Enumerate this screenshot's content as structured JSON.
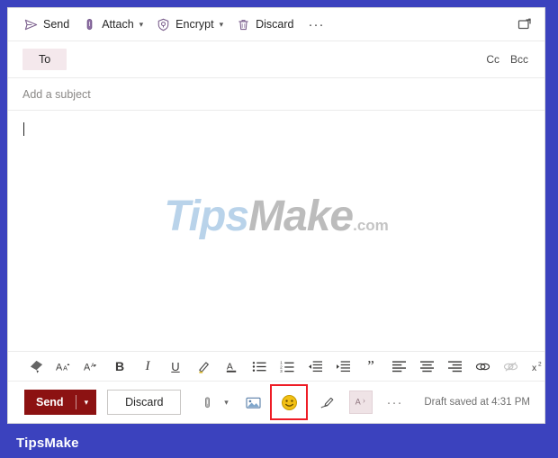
{
  "window": {
    "frame_color": "#3b42be",
    "background": "#ffffff"
  },
  "command_bar": {
    "items": [
      {
        "id": "send",
        "label": "Send",
        "icon": "send-icon",
        "has_chevron": false
      },
      {
        "id": "attach",
        "label": "Attach",
        "icon": "paperclip-icon",
        "has_chevron": true
      },
      {
        "id": "encrypt",
        "label": "Encrypt",
        "icon": "shield-lock-icon",
        "has_chevron": true
      },
      {
        "id": "discard",
        "label": "Discard",
        "icon": "trash-icon",
        "has_chevron": false
      }
    ],
    "overflow_label": "···",
    "popout_icon": "pop-out-icon"
  },
  "recipients": {
    "to_label": "To",
    "to_value": "",
    "to_placeholder": "",
    "cc_label": "Cc",
    "bcc_label": "Bcc"
  },
  "subject": {
    "value": "",
    "placeholder": "Add a subject"
  },
  "body": {
    "value": "",
    "placeholder": "",
    "watermark": {
      "part1": "Tips",
      "part2": "Make",
      "part3": ".com"
    }
  },
  "format_bar": {
    "items": [
      {
        "id": "format-painter",
        "icon": "format-painter-icon",
        "glyph": "✐",
        "disabled": false
      },
      {
        "id": "grow-font",
        "icon": "grow-font-icon",
        "glyph": "Aᴀ",
        "disabled": false
      },
      {
        "id": "shrink-font",
        "icon": "shrink-font-icon",
        "glyph": "Aˉ",
        "disabled": false
      },
      {
        "id": "bold",
        "icon": "bold-icon",
        "glyph": "B",
        "disabled": false
      },
      {
        "id": "italic",
        "icon": "italic-icon",
        "glyph": "I",
        "disabled": false
      },
      {
        "id": "underline",
        "icon": "underline-icon",
        "glyph": "U",
        "disabled": false
      },
      {
        "id": "highlight",
        "icon": "highlight-icon",
        "glyph": "✐",
        "disabled": false
      },
      {
        "id": "font-color",
        "icon": "font-color-icon",
        "glyph": "A",
        "disabled": false
      },
      {
        "id": "bulleted-list",
        "icon": "bulleted-list-icon",
        "glyph": "≡",
        "disabled": false
      },
      {
        "id": "numbered-list",
        "icon": "numbered-list-icon",
        "glyph": "≡",
        "disabled": false
      },
      {
        "id": "decrease-indent",
        "icon": "decrease-indent-icon",
        "glyph": "⇤",
        "disabled": false
      },
      {
        "id": "increase-indent",
        "icon": "increase-indent-icon",
        "glyph": "⇥",
        "disabled": false
      },
      {
        "id": "quote",
        "icon": "quote-icon",
        "glyph": "”",
        "disabled": false
      },
      {
        "id": "align-left",
        "icon": "align-left-icon",
        "glyph": "≡",
        "disabled": false
      },
      {
        "id": "align-center",
        "icon": "align-center-icon",
        "glyph": "≡",
        "disabled": false
      },
      {
        "id": "align-right",
        "icon": "align-right-icon",
        "glyph": "≡",
        "disabled": false
      },
      {
        "id": "insert-link",
        "icon": "link-icon",
        "glyph": "⚭",
        "disabled": false
      },
      {
        "id": "remove-link",
        "icon": "remove-link-icon",
        "glyph": "⚭",
        "disabled": true
      },
      {
        "id": "superscript",
        "icon": "superscript-icon",
        "glyph": "x²",
        "disabled": false
      }
    ],
    "overflow_label": "···"
  },
  "action_bar": {
    "send_label": "Send",
    "send_chevron": "∨",
    "send_color": "#8c1212",
    "discard_label": "Discard",
    "icons": [
      {
        "id": "attach-file",
        "icon": "paperclip-icon",
        "has_chevron": true
      },
      {
        "id": "insert-picture",
        "icon": "picture-icon",
        "has_chevron": false
      }
    ],
    "emoji": {
      "id": "insert-emoji",
      "icon": "smiley-emoji-icon",
      "highlighted": true,
      "highlight_color": "#ee1c25"
    },
    "signature": {
      "id": "signature",
      "icon": "signature-pen-icon"
    },
    "addins": {
      "id": "add-ins",
      "icon": "add-ins-icon"
    },
    "overflow_label": "···",
    "draft_status": "Draft saved at 4:31 PM"
  },
  "footer": {
    "brand": "TipsMake"
  }
}
